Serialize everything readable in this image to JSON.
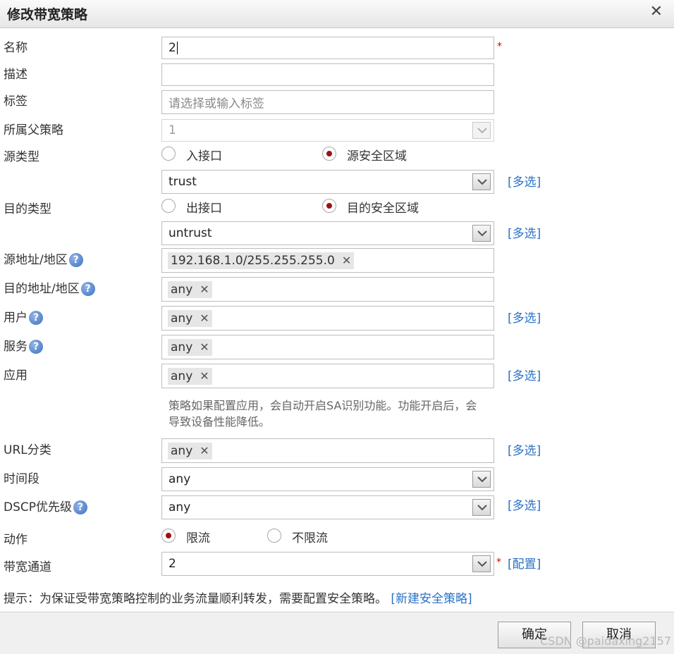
{
  "dialog": {
    "title": "修改带宽策略",
    "close": "✕"
  },
  "fields": {
    "name": {
      "label": "名称",
      "value": "2"
    },
    "desc": {
      "label": "描述",
      "value": ""
    },
    "tags": {
      "label": "标签",
      "placeholder": "请选择或输入标签"
    },
    "parent": {
      "label": "所属父策略",
      "value": "1"
    },
    "src_type": {
      "label": "源类型",
      "opt1": "入接口",
      "opt2": "源安全区域",
      "selected": "源安全区域",
      "zone": "trust"
    },
    "dst_type": {
      "label": "目的类型",
      "opt1": "出接口",
      "opt2": "目的安全区域",
      "selected": "目的安全区域",
      "zone": "untrust"
    },
    "src_addr": {
      "label": "源地址/地区",
      "tag": "192.168.1.0/255.255.255.0"
    },
    "dst_addr": {
      "label": "目的地址/地区",
      "tag": "any"
    },
    "user": {
      "label": "用户",
      "tag": "any"
    },
    "service": {
      "label": "服务",
      "tag": "any"
    },
    "app": {
      "label": "应用",
      "tag": "any",
      "note": "策略如果配置应用，会自动开启SA识别功能。功能开启后，会导致设备性能降低。"
    },
    "url": {
      "label": "URL分类",
      "tag": "any"
    },
    "time": {
      "label": "时间段",
      "value": "any"
    },
    "dscp": {
      "label": "DSCP优先级",
      "value": "any"
    },
    "action": {
      "label": "动作",
      "opt1": "限流",
      "opt2": "不限流",
      "selected": "限流"
    },
    "channel": {
      "label": "带宽通道",
      "value": "2"
    }
  },
  "links": {
    "multi": "[多选]",
    "config": "[配置]",
    "new_policy": "[新建安全策略]"
  },
  "tip": "提示：为保证受带宽策略控制的业务流量顺利转发，需要配置安全策略。",
  "buttons": {
    "ok": "确定",
    "cancel": "取消"
  },
  "help_glyph": "?",
  "required_mark": "*",
  "tag_remove": "✕",
  "watermark": "CSDN @paidaxing2157",
  "colors": {
    "link": "#2a72c8",
    "required": "#d40000",
    "radio_dot": "#a01010"
  }
}
